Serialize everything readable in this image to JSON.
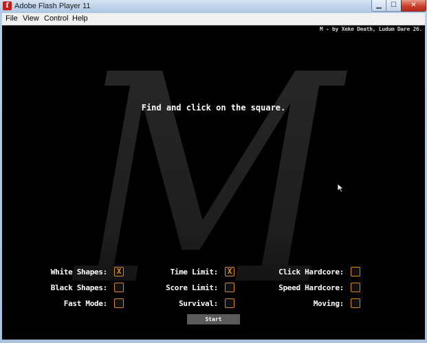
{
  "window": {
    "title": "Adobe Flash Player 11",
    "icon": "flash-icon",
    "controls": {
      "minimize": "▁",
      "maximize": "☐",
      "close": "✕"
    }
  },
  "menubar": {
    "items": [
      {
        "label": "File"
      },
      {
        "label": "View"
      },
      {
        "label": "Control"
      },
      {
        "label": "Help"
      }
    ]
  },
  "game": {
    "credit": "M - by Xeke Death, Ludum Dare 26.",
    "background_letter": "M",
    "instruction": "Find and click on the square.",
    "options": [
      {
        "label": "White Shapes:",
        "checked": true
      },
      {
        "label": "Black Shapes:",
        "checked": false
      },
      {
        "label": "Fast Mode:",
        "checked": false
      },
      {
        "label": "Time Limit:",
        "checked": true
      },
      {
        "label": "Score Limit:",
        "checked": false
      },
      {
        "label": "Survival:",
        "checked": false
      },
      {
        "label": "Click Hardcore:",
        "checked": false
      },
      {
        "label": "Speed Hardcore:",
        "checked": false
      },
      {
        "label": "Moving:",
        "checked": false
      }
    ],
    "check_mark": "X",
    "start_label": "Start",
    "colors": {
      "background": "#000000",
      "text": "#ffffff",
      "checkbox_border": "#d98a1e",
      "button": "#5a5a5a"
    }
  }
}
